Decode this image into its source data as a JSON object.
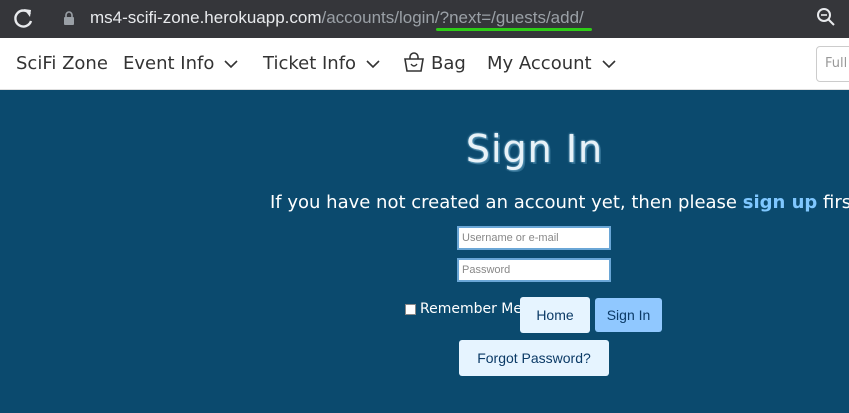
{
  "browser": {
    "url_host": "ms4-scifi-zone.herokuapp.com",
    "url_path": "/accounts/login/?next=/guests/add/"
  },
  "nav": {
    "brand": "SciFi Zone",
    "event_info": "Event Info",
    "ticket_info": "Ticket Info",
    "bag": "Bag",
    "my_account": "My Account",
    "search_placeholder": "Full"
  },
  "page": {
    "title": "Sign In",
    "subtitle_before": "If you have not created an account yet, then please ",
    "signup_link": "sign up",
    "subtitle_after": " first.",
    "username_placeholder": "Username or e-mail",
    "password_placeholder": "Password",
    "remember_label": "Remember Me",
    "home_button": "Home",
    "signin_button": "Sign In",
    "forgot_button": "Forgot Password?"
  },
  "colors": {
    "background": "#0b4a6e",
    "link": "#7fc7ff",
    "url_highlight": "#2ecc17"
  }
}
